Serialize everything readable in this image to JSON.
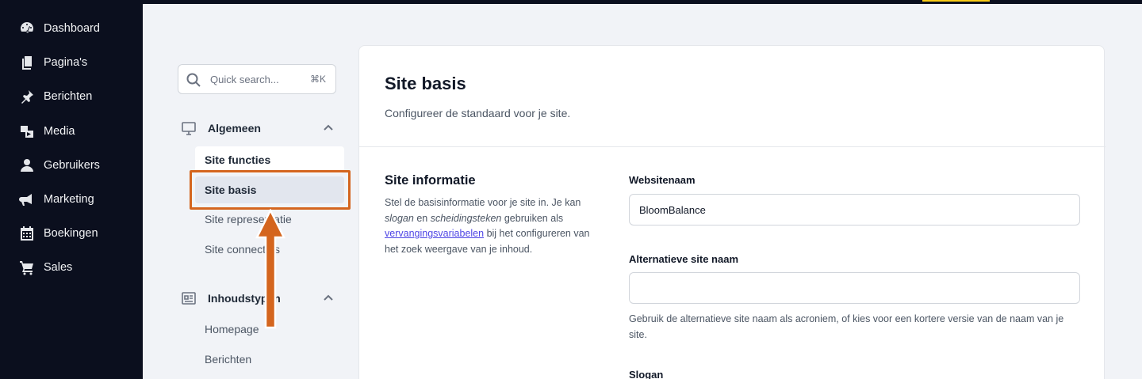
{
  "sidebar": {
    "items": [
      {
        "label": "Dashboard",
        "icon": "dashboard-icon"
      },
      {
        "label": "Pagina's",
        "icon": "pages-icon"
      },
      {
        "label": "Berichten",
        "icon": "pin-icon"
      },
      {
        "label": "Media",
        "icon": "media-icon"
      },
      {
        "label": "Gebruikers",
        "icon": "user-icon"
      },
      {
        "label": "Marketing",
        "icon": "megaphone-icon"
      },
      {
        "label": "Boekingen",
        "icon": "calendar-icon"
      },
      {
        "label": "Sales",
        "icon": "cart-icon"
      }
    ]
  },
  "search": {
    "placeholder": "Quick search...",
    "shortcut": "⌘K"
  },
  "settings_nav": {
    "groups": [
      {
        "label": "Algemeen",
        "icon": "monitor-icon",
        "items": [
          "Site functies",
          "Site basis",
          "Site representatie",
          "Site connecties"
        ]
      },
      {
        "label": "Inhoudstypen",
        "icon": "newspaper-icon",
        "items": [
          "Homepage",
          "Berichten"
        ]
      }
    ]
  },
  "page": {
    "title": "Site basis",
    "subtitle": "Configureer de standaard voor je site."
  },
  "section": {
    "title": "Site informatie",
    "desc_1": "Stel de basisinformatie voor je site in. Je kan ",
    "desc_em1": "slogan",
    "desc_2": " en ",
    "desc_em2": "scheidingsteken",
    "desc_3": " gebruiken als ",
    "desc_link": "vervangingsvariabelen",
    "desc_4": " bij het configureren van het zoek weergave van je inhoud."
  },
  "fields": {
    "website_name_label": "Websitenaam",
    "website_name_value": "BloomBalance",
    "alt_name_label": "Alternatieve site naam",
    "alt_name_value": "",
    "alt_name_help": "Gebruik de alternatieve site naam als acroniem, of kies voor een kortere versie van de naam van je site.",
    "slogan_label": "Slogan"
  },
  "colors": {
    "sidebar_bg": "#0b0f1e",
    "highlight": "#d4651e",
    "link": "#4f46e5"
  }
}
